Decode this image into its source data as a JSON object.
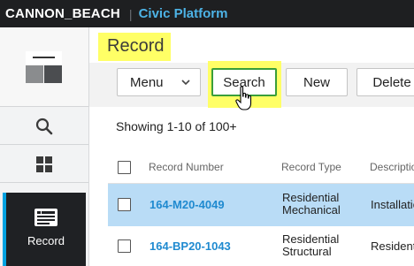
{
  "header": {
    "org": "CANNON_BEACH",
    "separator": "|",
    "platform": "Civic Platform"
  },
  "sidebar": {
    "items": [
      {
        "name": "search",
        "icon": "search-icon"
      },
      {
        "name": "apps",
        "icon": "grid-icon"
      },
      {
        "name": "record",
        "icon": "record-icon",
        "label": "Record",
        "active": true
      }
    ]
  },
  "page": {
    "title": "Record"
  },
  "toolbar": {
    "menu_label": "Menu",
    "search_label": "Search",
    "new_label": "New",
    "delete_label": "Delete"
  },
  "list": {
    "showing_text": "Showing 1-10 of 100+"
  },
  "table": {
    "columns": [
      "Record Number",
      "Record Type",
      "Descriptio"
    ],
    "rows": [
      {
        "record_number": "164-M20-4049",
        "type_line1": "Residential",
        "type_line2": "Mechanical",
        "description": "Installatio",
        "selected": true
      },
      {
        "record_number": "164-BP20-1043",
        "type_line1": "Residential",
        "type_line2": "Structural",
        "description": "Resident",
        "selected": false
      }
    ]
  },
  "colors": {
    "accent": "#00a2e1",
    "link": "#1f8ad0",
    "highlight": "#ffff66",
    "selected_row": "#b9dcf6",
    "topbar": "#1e1f21"
  }
}
